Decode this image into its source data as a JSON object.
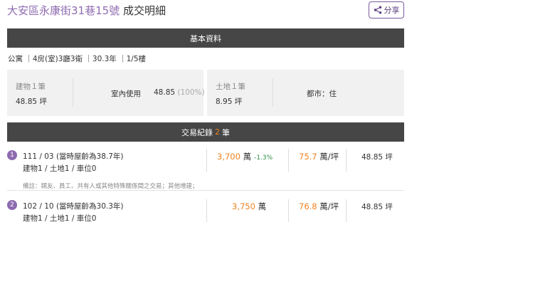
{
  "title": {
    "address": "大安區永康街31巷15號",
    "suffix": " 成交明細"
  },
  "share": {
    "label": "分享"
  },
  "basic_section": {
    "label": "基本資料"
  },
  "summary": "公寓 ｜4房(室)3廳3衛 ｜30.3年 ｜1/5樓",
  "building": {
    "label": "建物１筆",
    "value": "48.85 坪",
    "indoor_label": "室內使用",
    "indoor_value": "48.85",
    "indoor_pct": "(100%)"
  },
  "land": {
    "label": "土地１筆",
    "value": "8.95 坪",
    "zone": "都市：住"
  },
  "records_section": {
    "prefix": "交易紀錄",
    "count": "2",
    "suffix": "筆"
  },
  "records": [
    {
      "index": "1",
      "date": "111 / 03 (當時屋齡為38.7年)",
      "detail": "建物1 / 土地1 / 車位0",
      "price": "3,700",
      "price_unit": "萬",
      "change": "-1.3%",
      "unit_price": "75.7",
      "unit_price_unit": "萬/坪",
      "area": "48.85 坪",
      "note": "備註：親友、員工、共有人或其他特殊關係間之交易；其他增建；"
    },
    {
      "index": "2",
      "date": "102 / 10 (當時屋齡為30.3年)",
      "detail": "建物1 / 土地1 / 車位0",
      "price": "3,750",
      "price_unit": "萬",
      "unit_price": "76.8",
      "unit_price_unit": "萬/坪",
      "area": "48.85 坪"
    }
  ],
  "colors": {
    "accent": "#8e6bb0",
    "orange": "#f0821e",
    "bar": "#464646",
    "green": "#2f8f45"
  }
}
